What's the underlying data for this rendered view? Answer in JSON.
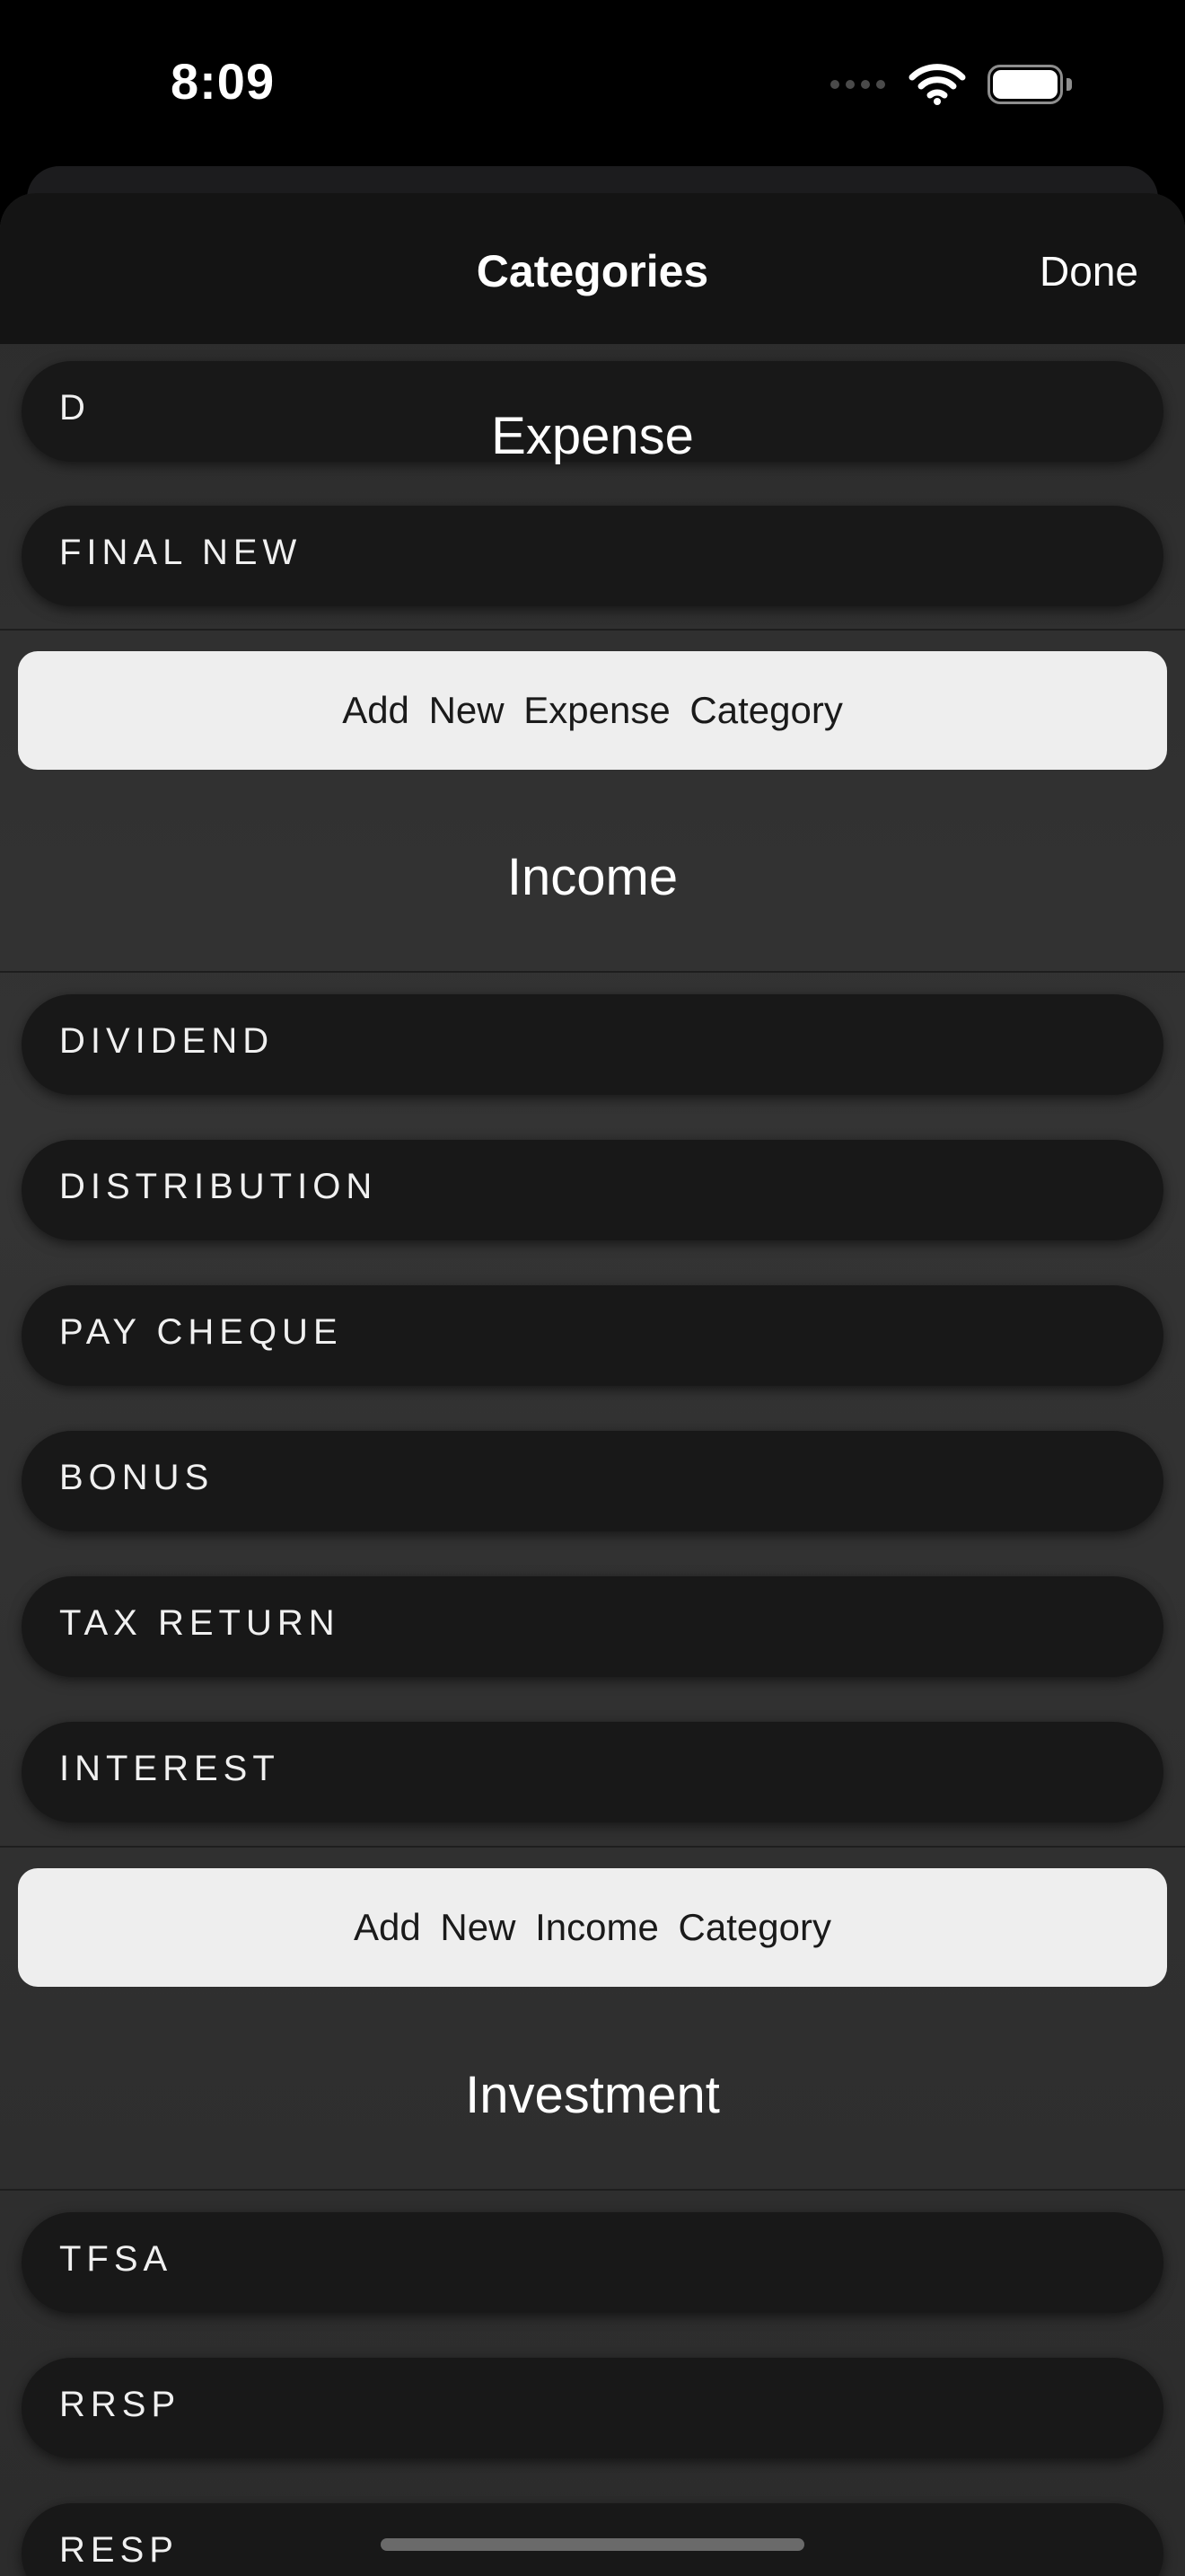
{
  "status_bar": {
    "time": "8:09",
    "icons": [
      "signal-dots-icon",
      "wifi-icon",
      "battery-icon"
    ]
  },
  "nav": {
    "title": "Categories",
    "done_label": "Done"
  },
  "colors": {
    "nav_background": "#141414",
    "sheet_background": "#2c2c2c",
    "row_background": "#181818",
    "button_background": "#eeeeee",
    "button_text": "#1a1a1a"
  },
  "sections": {
    "expense": {
      "title": "Expense",
      "items": [
        {
          "label": "D"
        },
        {
          "label": "FINAL NEW"
        }
      ],
      "add_label": "Add New  Expense  Category"
    },
    "income": {
      "title": "Income",
      "items": [
        {
          "label": "DIVIDEND"
        },
        {
          "label": "DISTRIBUTION"
        },
        {
          "label": "PAY CHEQUE"
        },
        {
          "label": "BONUS"
        },
        {
          "label": "TAX RETURN"
        },
        {
          "label": "INTEREST"
        }
      ],
      "add_label": "Add New  Income  Category"
    },
    "investment": {
      "title": "Investment",
      "items": [
        {
          "label": "TFSA"
        },
        {
          "label": "RRSP"
        },
        {
          "label": "RESP"
        }
      ]
    }
  }
}
